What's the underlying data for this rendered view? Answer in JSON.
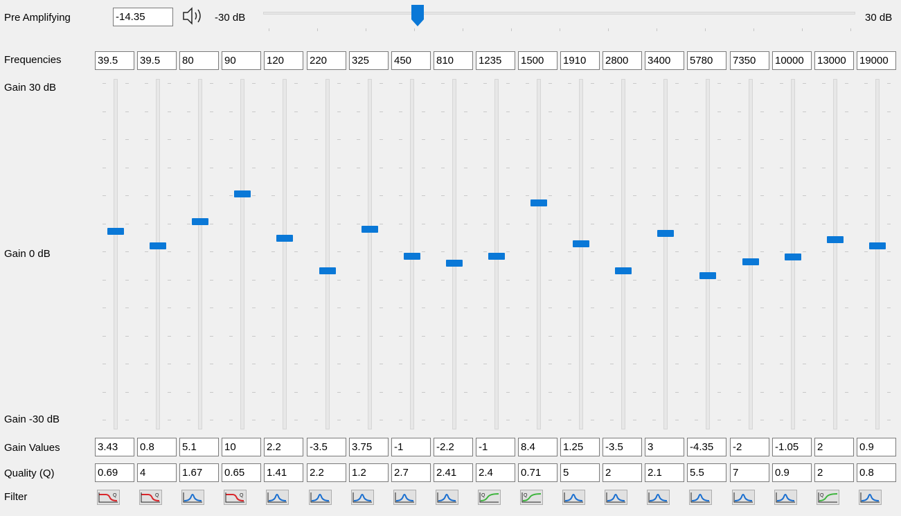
{
  "preamp": {
    "label": "Pre Amplifying",
    "value": "-14.35",
    "min_label": "-30 dB",
    "max_label": "30 dB",
    "level_db": -14.35,
    "range_db": [
      -30,
      30
    ],
    "icon": "speaker-icon"
  },
  "labels": {
    "frequencies": "Frequencies",
    "gain_max": "Gain 30 dB",
    "gain_zero": "Gain 0 dB",
    "gain_min": "Gain -30 dB",
    "gain_values": "Gain Values",
    "quality": "Quality (Q)",
    "filter": "Filter"
  },
  "gain_range_db": [
    -30,
    30
  ],
  "bands": [
    {
      "freq": "39.5",
      "gain": "3.43",
      "q": "0.69",
      "filter": "low-shelf-icon"
    },
    {
      "freq": "39.5",
      "gain": "0.8",
      "q": "4",
      "filter": "low-shelf-icon"
    },
    {
      "freq": "80",
      "gain": "5.1",
      "q": "1.67",
      "filter": "peak-filter-icon"
    },
    {
      "freq": "90",
      "gain": "10",
      "q": "0.65",
      "filter": "low-shelf-icon"
    },
    {
      "freq": "120",
      "gain": "2.2",
      "q": "1.41",
      "filter": "peak-filter-icon"
    },
    {
      "freq": "220",
      "gain": "-3.5",
      "q": "2.2",
      "filter": "peak-filter-icon"
    },
    {
      "freq": "325",
      "gain": "3.75",
      "q": "1.2",
      "filter": "peak-filter-icon"
    },
    {
      "freq": "450",
      "gain": "-1",
      "q": "2.7",
      "filter": "peak-filter-icon"
    },
    {
      "freq": "810",
      "gain": "-2.2",
      "q": "2.41",
      "filter": "peak-filter-icon"
    },
    {
      "freq": "1235",
      "gain": "-1",
      "q": "2.4",
      "filter": "high-shelf-icon"
    },
    {
      "freq": "1500",
      "gain": "8.4",
      "q": "0.71",
      "filter": "high-shelf-icon"
    },
    {
      "freq": "1910",
      "gain": "1.25",
      "q": "5",
      "filter": "peak-filter-icon"
    },
    {
      "freq": "2800",
      "gain": "-3.5",
      "q": "2",
      "filter": "peak-filter-icon"
    },
    {
      "freq": "3400",
      "gain": "3",
      "q": "2.1",
      "filter": "peak-filter-icon"
    },
    {
      "freq": "5780",
      "gain": "-4.35",
      "q": "5.5",
      "filter": "peak-filter-icon"
    },
    {
      "freq": "7350",
      "gain": "-2",
      "q": "7",
      "filter": "peak-filter-icon"
    },
    {
      "freq": "10000",
      "gain": "-1.05",
      "q": "0.9",
      "filter": "peak-filter-icon"
    },
    {
      "freq": "13000",
      "gain": "2",
      "q": "2",
      "filter": "high-shelf-icon"
    },
    {
      "freq": "19000",
      "gain": "0.9",
      "q": "0.8",
      "filter": "peak-filter-icon"
    }
  ],
  "colors": {
    "accent": "#0a78d7",
    "low_shelf": "#d9252a",
    "high_shelf": "#3cb43c",
    "peak": "#1a6fd0"
  }
}
